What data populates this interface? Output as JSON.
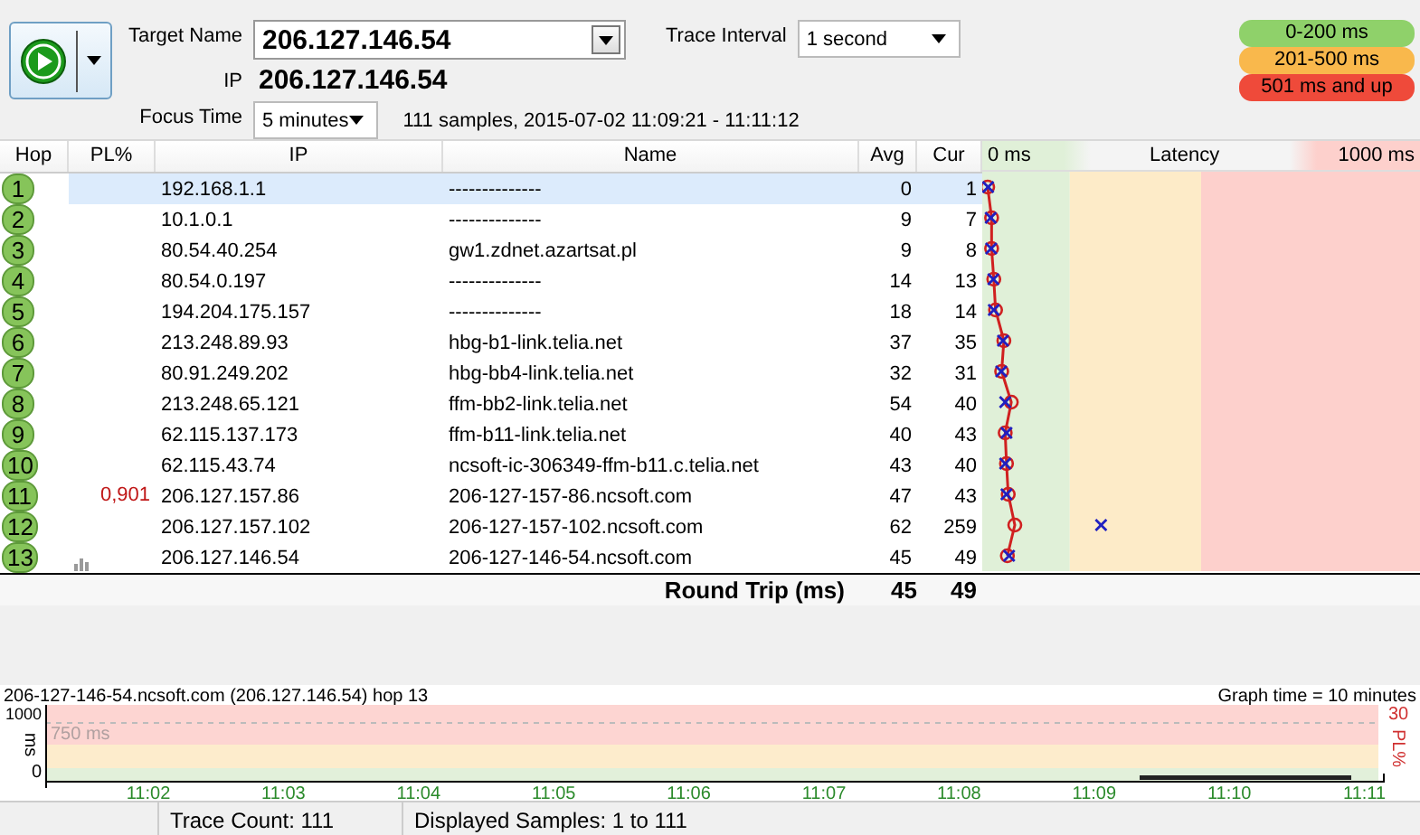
{
  "toolbar": {
    "target_name_label": "Target Name",
    "target_name": "206.127.146.54",
    "ip_label": "IP",
    "ip": "206.127.146.54",
    "focus_time_label": "Focus Time",
    "focus_time": "5 minutes",
    "samples_info": "111 samples, 2015-07-02 11:09:21 - 11:11:12",
    "trace_interval_label": "Trace Interval",
    "trace_interval": "1 second"
  },
  "legend": [
    {
      "label": "0-200 ms",
      "color": "#8fd16a"
    },
    {
      "label": "201-500 ms",
      "color": "#f9b84c"
    },
    {
      "label": "501 ms and up",
      "color": "#ef4a3a"
    }
  ],
  "table": {
    "columns": [
      "Hop",
      "PL%",
      "IP",
      "Name",
      "Avg",
      "Cur"
    ],
    "latency_header": {
      "min": "0 ms",
      "title": "Latency",
      "max": "1000 ms"
    },
    "rows": [
      {
        "hop": "1",
        "ip": "192.168.1.1",
        "name": "--------------",
        "avg": "0",
        "cur": "1",
        "selected": true,
        "graphed": false
      },
      {
        "hop": "2",
        "ip": "10.1.0.1",
        "name": "--------------",
        "avg": "9",
        "cur": "7",
        "selected": false,
        "graphed": false
      },
      {
        "hop": "3",
        "ip": "80.54.40.254",
        "name": "gw1.zdnet.azartsat.pl",
        "avg": "9",
        "cur": "8",
        "selected": false,
        "graphed": false
      },
      {
        "hop": "4",
        "ip": "80.54.0.197",
        "name": "--------------",
        "avg": "14",
        "cur": "13",
        "selected": false,
        "graphed": false
      },
      {
        "hop": "5",
        "ip": "194.204.175.157",
        "name": "--------------",
        "avg": "18",
        "cur": "14",
        "selected": false,
        "graphed": false
      },
      {
        "hop": "6",
        "ip": "213.248.89.93",
        "name": "hbg-b1-link.telia.net",
        "avg": "37",
        "cur": "35",
        "selected": false,
        "graphed": false
      },
      {
        "hop": "7",
        "ip": "80.91.249.202",
        "name": "hbg-bb4-link.telia.net",
        "avg": "32",
        "cur": "31",
        "selected": false,
        "graphed": false
      },
      {
        "hop": "8",
        "ip": "213.248.65.121",
        "name": "ffm-bb2-link.telia.net",
        "avg": "54",
        "cur": "40",
        "selected": false,
        "graphed": false
      },
      {
        "hop": "9",
        "ip": "62.115.137.173",
        "name": "ffm-b11-link.telia.net",
        "avg": "40",
        "cur": "43",
        "selected": false,
        "graphed": false
      },
      {
        "hop": "10",
        "ip": "62.115.43.74",
        "name": "ncsoft-ic-306349-ffm-b11.c.telia.net",
        "avg": "43",
        "cur": "40",
        "selected": false,
        "graphed": false
      },
      {
        "hop": "11",
        "pl": "0,901",
        "ip": "206.127.157.86",
        "name": "206-127-157-86.ncsoft.com",
        "avg": "47",
        "cur": "43",
        "selected": false,
        "graphed": false
      },
      {
        "hop": "12",
        "ip": "206.127.157.102",
        "name": "206-127-157-102.ncsoft.com",
        "avg": "62",
        "cur": "259",
        "selected": false,
        "graphed": false
      },
      {
        "hop": "13",
        "ip": "206.127.146.54",
        "name": "206-127-146-54.ncsoft.com",
        "avg": "45",
        "cur": "49",
        "selected": false,
        "graphed": true
      }
    ],
    "round_trip": {
      "label": "Round Trip (ms)",
      "avg": "45",
      "cur": "49"
    }
  },
  "graph": {
    "title": "206-127-146-54.ncsoft.com (206.127.146.54) hop 13",
    "graph_time": "Graph time = 10 minutes",
    "y_unit": "ms",
    "y_ticks": [
      "1000",
      "0"
    ],
    "threshold_label": "750 ms",
    "pl_tick": "30",
    "pl_label": "PL%",
    "x_ticks": [
      "11:02",
      "11:03",
      "11:04",
      "11:05",
      "11:06",
      "11:07",
      "11:08",
      "11:09",
      "11:10",
      "11:11"
    ]
  },
  "status_bar": {
    "trace_count": "Trace Count: 111",
    "displayed_samples": "Displayed Samples: 1 to 111"
  }
}
